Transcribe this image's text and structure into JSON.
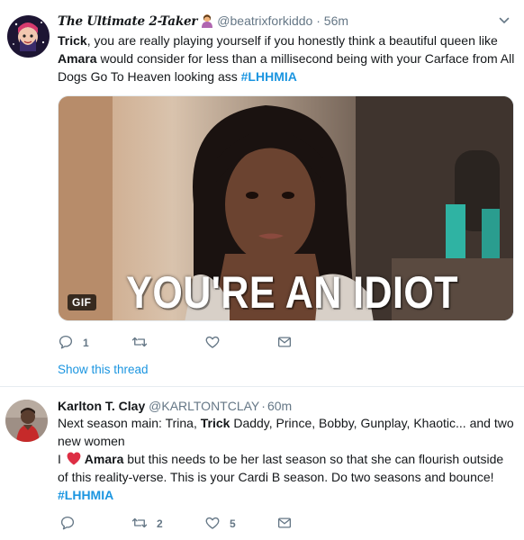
{
  "tweets": [
    {
      "display_name": "The Ultimate 2-Taker",
      "handle": "@beatrixforkiddo",
      "separator": "·",
      "time": "56m",
      "text_parts": {
        "p1": "Trick",
        "p2": ", you are really playing yourself if you honestly think a beautiful queen like ",
        "p3": "Amara",
        "p4": " would consider for less than a millisecond being with your Carface from All Dogs Go To Heaven looking ass ",
        "p5": "#LHHMIA"
      },
      "media": {
        "badge": "GIF",
        "caption": "YOU'RE AN IDIOT"
      },
      "actions": {
        "reply_count": "1",
        "retweet_count": "",
        "like_count": ""
      },
      "show_thread": "Show this thread"
    },
    {
      "display_name": "Karlton T. Clay",
      "handle": "@KARLTONTCLAY",
      "separator": "·",
      "time": "60m",
      "text_parts": {
        "p1": "Next season main: Trina, ",
        "p2": "Trick",
        "p3": " Daddy, Prince, Bobby, Gunplay, Khaotic... and two new women",
        "p4": "I ",
        "p5": "Amara",
        "p6": " but this needs to be her last season so that she can flourish outside of this reality-verse. This is your Cardi B season. Do two seasons and bounce!",
        "p7": "#LHHMIA"
      },
      "actions": {
        "reply_count": "",
        "retweet_count": "2",
        "like_count": "5"
      }
    }
  ],
  "colors": {
    "link": "#1b95e0",
    "muted": "#657786",
    "text": "#14171a",
    "heart": "#e0245e",
    "divider": "#e6ecf0"
  },
  "icons": [
    "chevron-down-icon",
    "reply-icon",
    "retweet-icon",
    "like-icon",
    "direct-message-icon",
    "red-heart-emoji",
    "person-emoji"
  ]
}
